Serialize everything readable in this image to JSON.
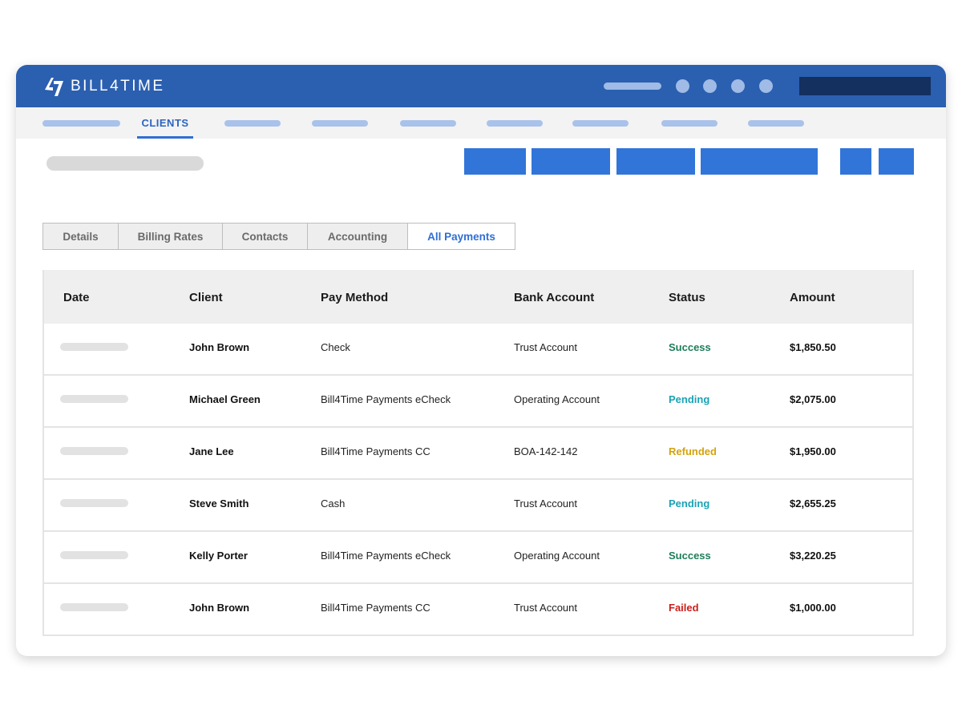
{
  "app": {
    "brand": "BILL4TIME",
    "colors": {
      "header": "#2b5fb0",
      "accent": "#3275d9",
      "success": "#1e7d5a",
      "pending": "#1aa3b5",
      "refunded": "#d4a20b",
      "failed": "#c8201c"
    }
  },
  "nav": {
    "active_label": "CLIENTS"
  },
  "tabs": [
    {
      "label": "Details"
    },
    {
      "label": "Billing Rates"
    },
    {
      "label": "Contacts"
    },
    {
      "label": "Accounting"
    },
    {
      "label": "All Payments"
    }
  ],
  "table": {
    "headers": {
      "date": "Date",
      "client": "Client",
      "pay_method": "Pay Method",
      "bank_account": "Bank Account",
      "status": "Status",
      "amount": "Amount"
    },
    "rows": [
      {
        "client": "John Brown",
        "pay_method": "Check",
        "bank_account": "Trust Account",
        "status": "Success",
        "amount": "$1,850.50"
      },
      {
        "client": "Michael Green",
        "pay_method": "Bill4Time Payments eCheck",
        "bank_account": "Operating Account",
        "status": "Pending",
        "amount": "$2,075.00"
      },
      {
        "client": "Jane Lee",
        "pay_method": "Bill4Time Payments CC",
        "bank_account": "BOA-142-142",
        "status": "Refunded",
        "amount": "$1,950.00"
      },
      {
        "client": "Steve Smith",
        "pay_method": "Cash",
        "bank_account": "Trust Account",
        "status": "Pending",
        "amount": "$2,655.25"
      },
      {
        "client": "Kelly Porter",
        "pay_method": "Bill4Time Payments eCheck",
        "bank_account": "Operating Account",
        "status": "Success",
        "amount": "$3,220.25"
      },
      {
        "client": "John Brown",
        "pay_method": "Bill4Time Payments CC",
        "bank_account": "Trust Account",
        "status": "Failed",
        "amount": "$1,000.00"
      }
    ]
  }
}
